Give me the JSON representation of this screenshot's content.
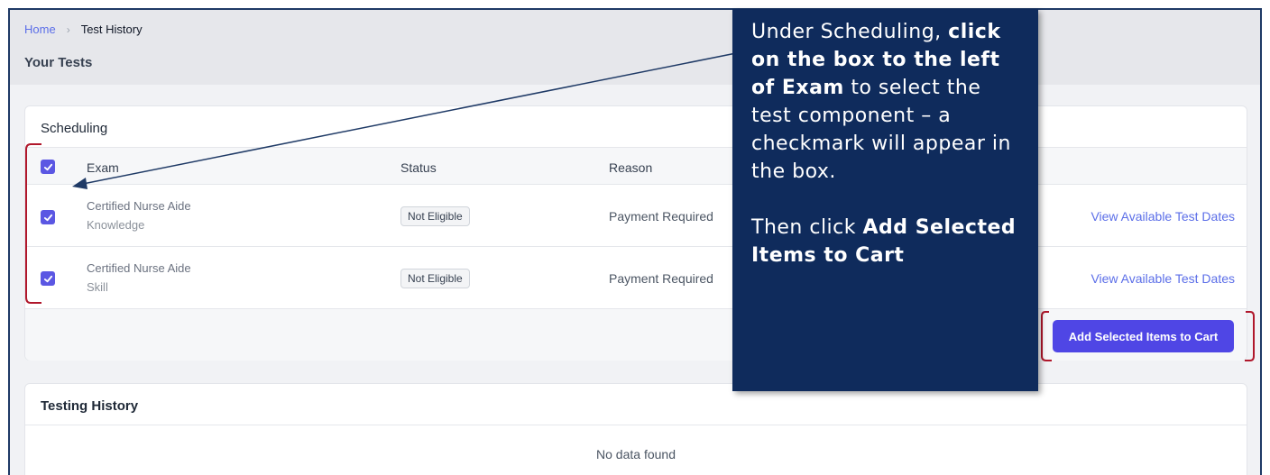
{
  "breadcrumb": {
    "home": "Home",
    "separator": "›",
    "current": "Test History"
  },
  "page_title": "Your Tests",
  "scheduling": {
    "title": "Scheduling",
    "columns": {
      "exam": "Exam",
      "status": "Status",
      "reason": "Reason"
    },
    "header_checkbox_checked": true,
    "rows": [
      {
        "checked": true,
        "exam": "Certified Nurse Aide",
        "component": "Knowledge",
        "status": "Not Eligible",
        "reason": "Payment Required",
        "action": "View Available Test Dates"
      },
      {
        "checked": true,
        "exam": "Certified Nurse Aide",
        "component": "Skill",
        "status": "Not Eligible",
        "reason": "Payment Required",
        "action": "View Available Test Dates"
      }
    ],
    "add_button": "Add Selected Items to Cart"
  },
  "testing_history": {
    "title": "Testing History",
    "empty": "No data found"
  },
  "callout": {
    "line1_pre": "Under Scheduling, ",
    "line1_bold": "click on the box to the left of Exam",
    "line1_post": " to select the test component – a checkmark will appear in the box.",
    "line2_pre": "Then click ",
    "line2_bold": "Add Selected Items to Cart"
  },
  "colors": {
    "accent": "#4f46e5",
    "link": "#5b6ee8",
    "callout_bg": "#0f2b5c",
    "annotation_red": "#b0172b"
  }
}
